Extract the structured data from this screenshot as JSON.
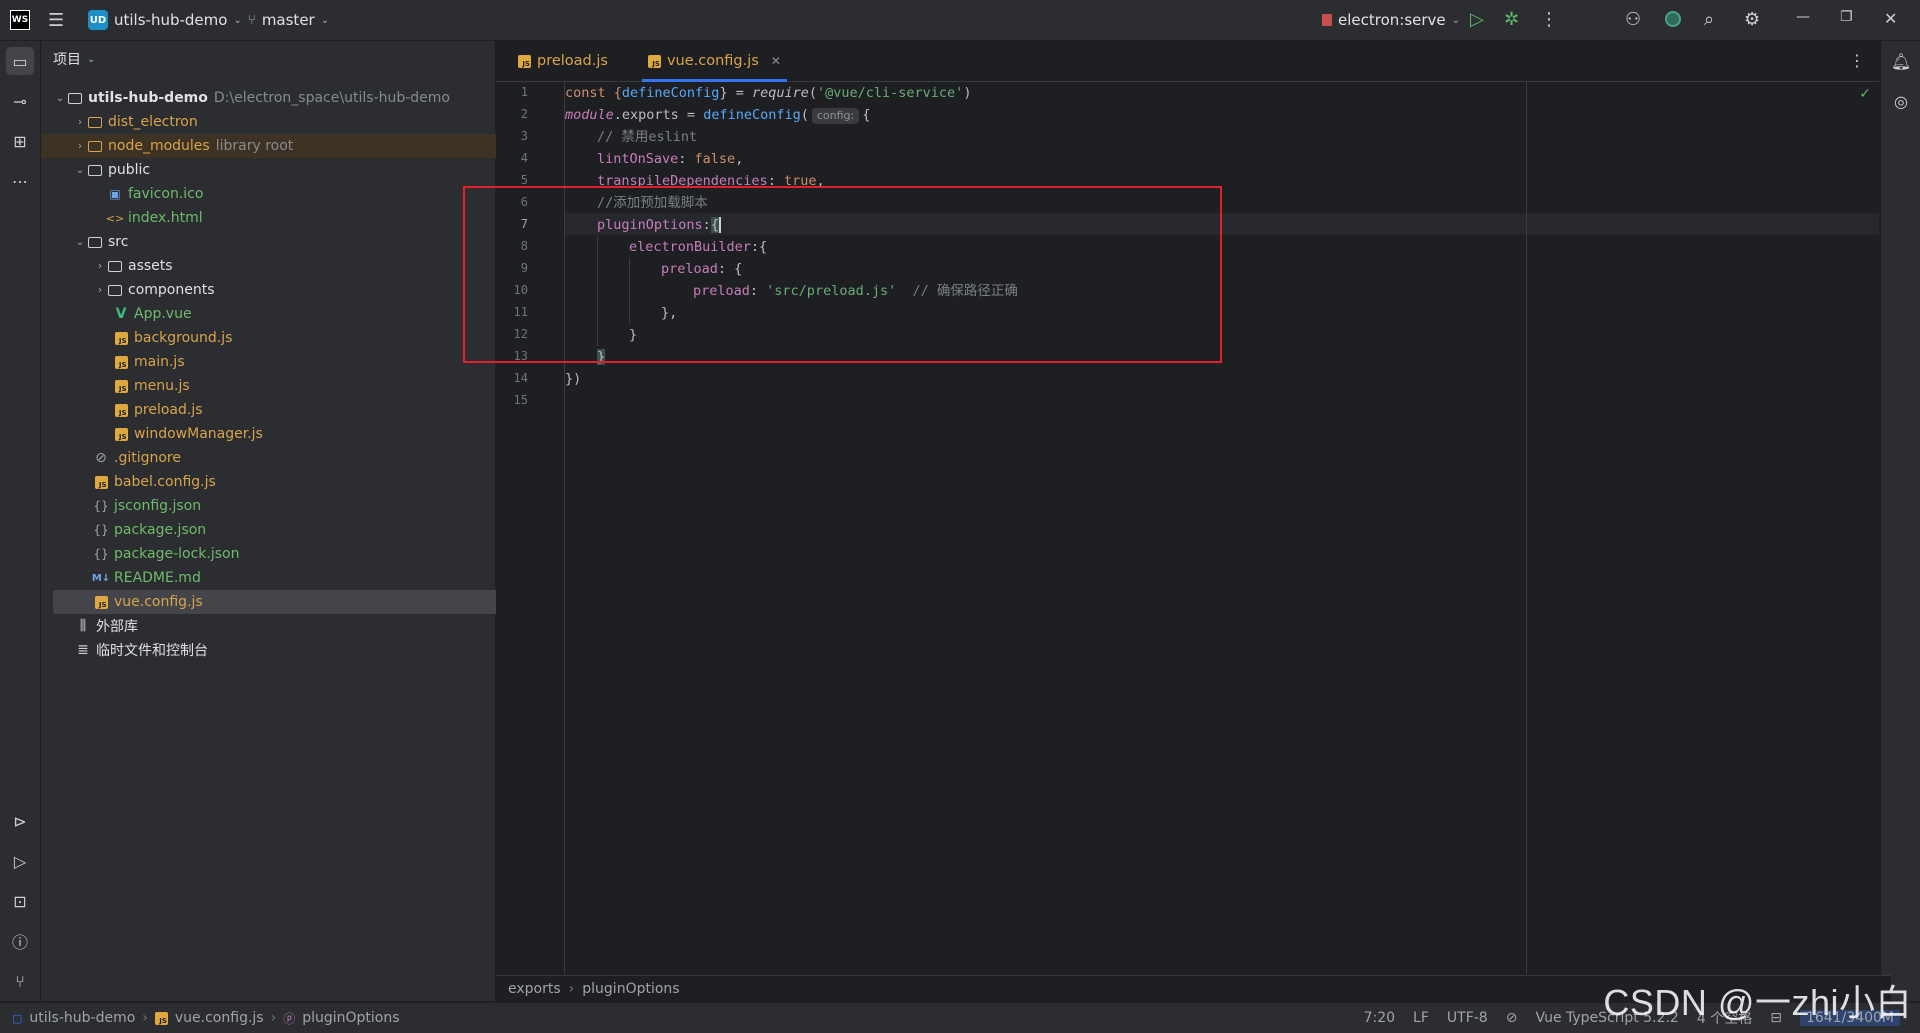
{
  "titlebar": {
    "app_logo": "WS",
    "project_badge": "UD",
    "project_name": "utils-hub-demo",
    "branch": "master",
    "run_config": "electron:serve"
  },
  "project_panel": {
    "title": "项目",
    "root_name": "utils-hub-demo",
    "root_path": "D:\\electron_space\\utils-hub-demo",
    "items": [
      {
        "label": "dist_electron",
        "note": "",
        "type": "folder"
      },
      {
        "label": "node_modules",
        "note": "library root",
        "type": "folder"
      },
      {
        "label": "public",
        "note": "",
        "type": "folder"
      },
      {
        "label": "favicon.ico",
        "note": "",
        "type": "ico"
      },
      {
        "label": "index.html",
        "note": "",
        "type": "html"
      },
      {
        "label": "src",
        "note": "",
        "type": "folder"
      },
      {
        "label": "assets",
        "note": "",
        "type": "folder"
      },
      {
        "label": "components",
        "note": "",
        "type": "folder"
      },
      {
        "label": "App.vue",
        "note": "",
        "type": "vue"
      },
      {
        "label": "background.js",
        "note": "",
        "type": "js"
      },
      {
        "label": "main.js",
        "note": "",
        "type": "js"
      },
      {
        "label": "menu.js",
        "note": "",
        "type": "js"
      },
      {
        "label": "preload.js",
        "note": "",
        "type": "js"
      },
      {
        "label": "windowManager.js",
        "note": "",
        "type": "js"
      },
      {
        "label": ".gitignore",
        "note": "",
        "type": "ignore"
      },
      {
        "label": "babel.config.js",
        "note": "",
        "type": "js"
      },
      {
        "label": "jsconfig.json",
        "note": "",
        "type": "json"
      },
      {
        "label": "package.json",
        "note": "",
        "type": "json"
      },
      {
        "label": "package-lock.json",
        "note": "",
        "type": "json"
      },
      {
        "label": "README.md",
        "note": "",
        "type": "md"
      },
      {
        "label": "vue.config.js",
        "note": "",
        "type": "js"
      },
      {
        "label": "外部库",
        "note": "",
        "type": "lib"
      },
      {
        "label": "临时文件和控制台",
        "note": "",
        "type": "scratch"
      }
    ]
  },
  "editor": {
    "tabs": [
      {
        "label": "preload.js",
        "active": false
      },
      {
        "label": "vue.config.js",
        "active": true
      }
    ],
    "line_numbers": [
      "1",
      "2",
      "3",
      "4",
      "5",
      "6",
      "7",
      "8",
      "9",
      "10",
      "11",
      "12",
      "13",
      "14",
      "15"
    ],
    "current_line": "7",
    "code": {
      "l1_a": "const {",
      "l1_b": "defineConfig",
      "l1_c": "} = ",
      "l1_d": "require",
      "l1_e": "(",
      "l1_f": "'@vue/cli-service'",
      "l1_g": ")",
      "l2_a": "module",
      "l2_b": ".exports = ",
      "l2_c": "defineConfig",
      "l2_d": "(",
      "l2_hint": "config:",
      "l2_e": "{",
      "l3": "// 禁用eslint",
      "l4_a": "lintOnSave",
      "l4_b": ": ",
      "l4_c": "false",
      "l4_d": ",",
      "l5_a": "transpileDependencies",
      "l5_b": ": ",
      "l5_c": "true",
      "l5_d": ",",
      "l6": "//添加预加载脚本",
      "l7_a": "pluginOptions",
      "l7_b": ":",
      "l7_c": "{",
      "l8_a": "electronBuilder",
      "l8_b": ":{",
      "l9_a": "preload",
      "l9_b": ": {",
      "l10_a": "preload",
      "l10_b": ": ",
      "l10_c": "'src/preload.js'",
      "l10_d": "  // 确保路径正确",
      "l11": "},",
      "l12": "}",
      "l13": "}",
      "l14": "})"
    }
  },
  "breadcrumb": {
    "a": "exports",
    "b": "pluginOptions"
  },
  "statusbar": {
    "project": "utils-hub-demo",
    "file": "vue.config.js",
    "symbol": "pluginOptions",
    "position": "7:20",
    "line_sep": "LF",
    "encoding": "UTF-8",
    "language": "Vue TypeScript 5.2.2",
    "indent": "4 个空格",
    "memory": "1641/3400M"
  },
  "watermark": "CSDN @一zhi小白",
  "colors": {
    "accent": "#3574f0",
    "highlight_box": "#e0202a",
    "js_icon": "#e0a940"
  }
}
